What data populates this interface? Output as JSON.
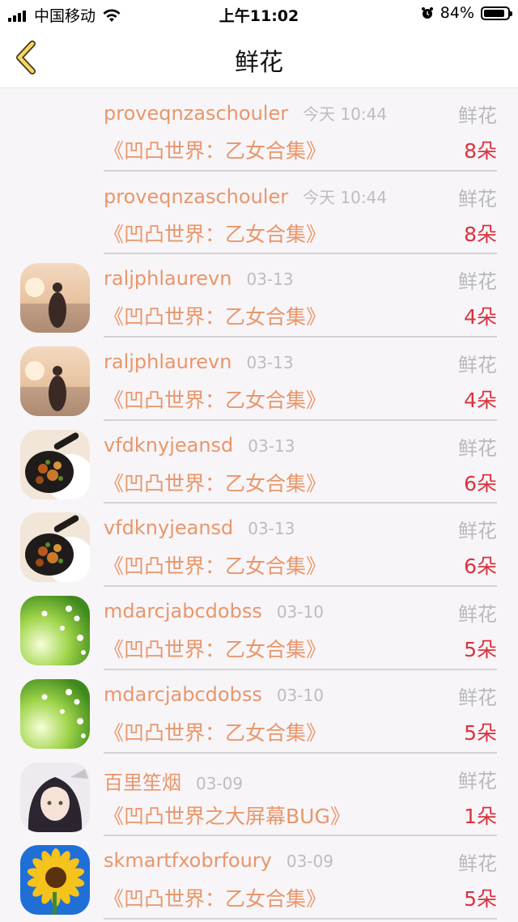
{
  "status_bar": {
    "carrier": "中国移动",
    "time": "上午11:02",
    "battery": "84%",
    "battery_level": 0.84
  },
  "nav": {
    "title": "鲜花"
  },
  "rows": [
    {
      "avatar": "none",
      "username": "proveqnzaschouler",
      "time": "今天 10:44",
      "type": "鲜花",
      "book": "《凹凸世界：乙女合集》",
      "count": "8朵"
    },
    {
      "avatar": "none",
      "username": "proveqnzaschouler",
      "time": "今天 10:44",
      "type": "鲜花",
      "book": "《凹凸世界：乙女合集》",
      "count": "8朵"
    },
    {
      "avatar": "beach-girl-avatar",
      "username": "raljphlaurevn",
      "time": "03-13",
      "type": "鲜花",
      "book": "《凹凸世界：乙女合集》",
      "count": "4朵"
    },
    {
      "avatar": "beach-girl-avatar",
      "username": "raljphlaurevn",
      "time": "03-13",
      "type": "鲜花",
      "book": "《凹凸世界：乙女合集》",
      "count": "4朵"
    },
    {
      "avatar": "skillet-food-avatar",
      "username": "vfdknyjeansd",
      "time": "03-13",
      "type": "鲜花",
      "book": "《凹凸世界：乙女合集》",
      "count": "6朵"
    },
    {
      "avatar": "skillet-food-avatar",
      "username": "vfdknyjeansd",
      "time": "03-13",
      "type": "鲜花",
      "book": "《凹凸世界：乙女合集》",
      "count": "6朵"
    },
    {
      "avatar": "green-flowers-avatar",
      "username": "mdarcjabcdobss",
      "time": "03-10",
      "type": "鲜花",
      "book": "《凹凸世界：乙女合集》",
      "count": "5朵"
    },
    {
      "avatar": "green-flowers-avatar",
      "username": "mdarcjabcdobss",
      "time": "03-10",
      "type": "鲜花",
      "book": "《凹凸世界：乙女合集》",
      "count": "5朵"
    },
    {
      "avatar": "anime-girl-avatar",
      "username": "百里笙烟",
      "time": "03-09",
      "type": "鲜花",
      "book": "《凹凸世界之大屏幕BUG》",
      "count": "1朵"
    },
    {
      "avatar": "sunflower-avatar",
      "username": "skmartfxobrfoury",
      "time": "03-09",
      "type": "鲜花",
      "book": "《凹凸世界：乙女合集》",
      "count": "5朵"
    }
  ],
  "colors": {
    "username": "#e9966a",
    "count": "#d9333e",
    "muted": "#bdbcbf",
    "list_bg": "#f7f5f8"
  }
}
